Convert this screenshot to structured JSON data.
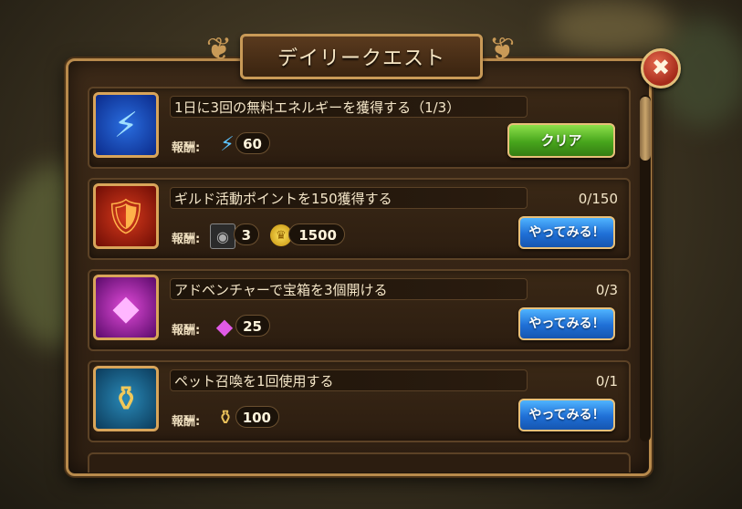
{
  "window": {
    "title": "デイリークエスト"
  },
  "colors": {
    "panel_border": "#b88a4c",
    "button_blue": "#1f6fd6",
    "button_green": "#47a51c",
    "close_red": "#a52a1a"
  },
  "icons": {
    "close": "close-x-icon",
    "wing": "ornamental-wing-icon"
  },
  "quests": [
    {
      "title": "1日に3回の無料エネルギーを獲得する（1/3）",
      "icon": "energy-lightning-icon",
      "reward_label": "報酬:",
      "rewards": [
        {
          "icon": "energy-lightning-icon",
          "value": "60"
        }
      ],
      "progress": "",
      "button": "クリア"
    },
    {
      "title": "ギルド活動ポイントを150獲得する",
      "icon": "guild-shield-flame-icon",
      "reward_label": "報酬:",
      "rewards": [
        {
          "icon": "token-medal-icon",
          "value": "3"
        },
        {
          "icon": "gold-coin-icon",
          "value": "1500"
        }
      ],
      "progress": "0/150",
      "button": "やってみる！"
    },
    {
      "title": "アドベンチャーで宝箱を3個開ける",
      "icon": "purple-crystal-cube-icon",
      "reward_label": "報酬:",
      "rewards": [
        {
          "icon": "purple-gem-icon",
          "value": "25"
        }
      ],
      "progress": "0/3",
      "button": "やってみる！"
    },
    {
      "title": "ペット召喚を1回使用する",
      "icon": "pet-summon-bottle-icon",
      "reward_label": "報酬:",
      "rewards": [
        {
          "icon": "pet-summon-bottle-icon",
          "value": "100"
        }
      ],
      "progress": "0/1",
      "button": "やってみる！"
    }
  ]
}
